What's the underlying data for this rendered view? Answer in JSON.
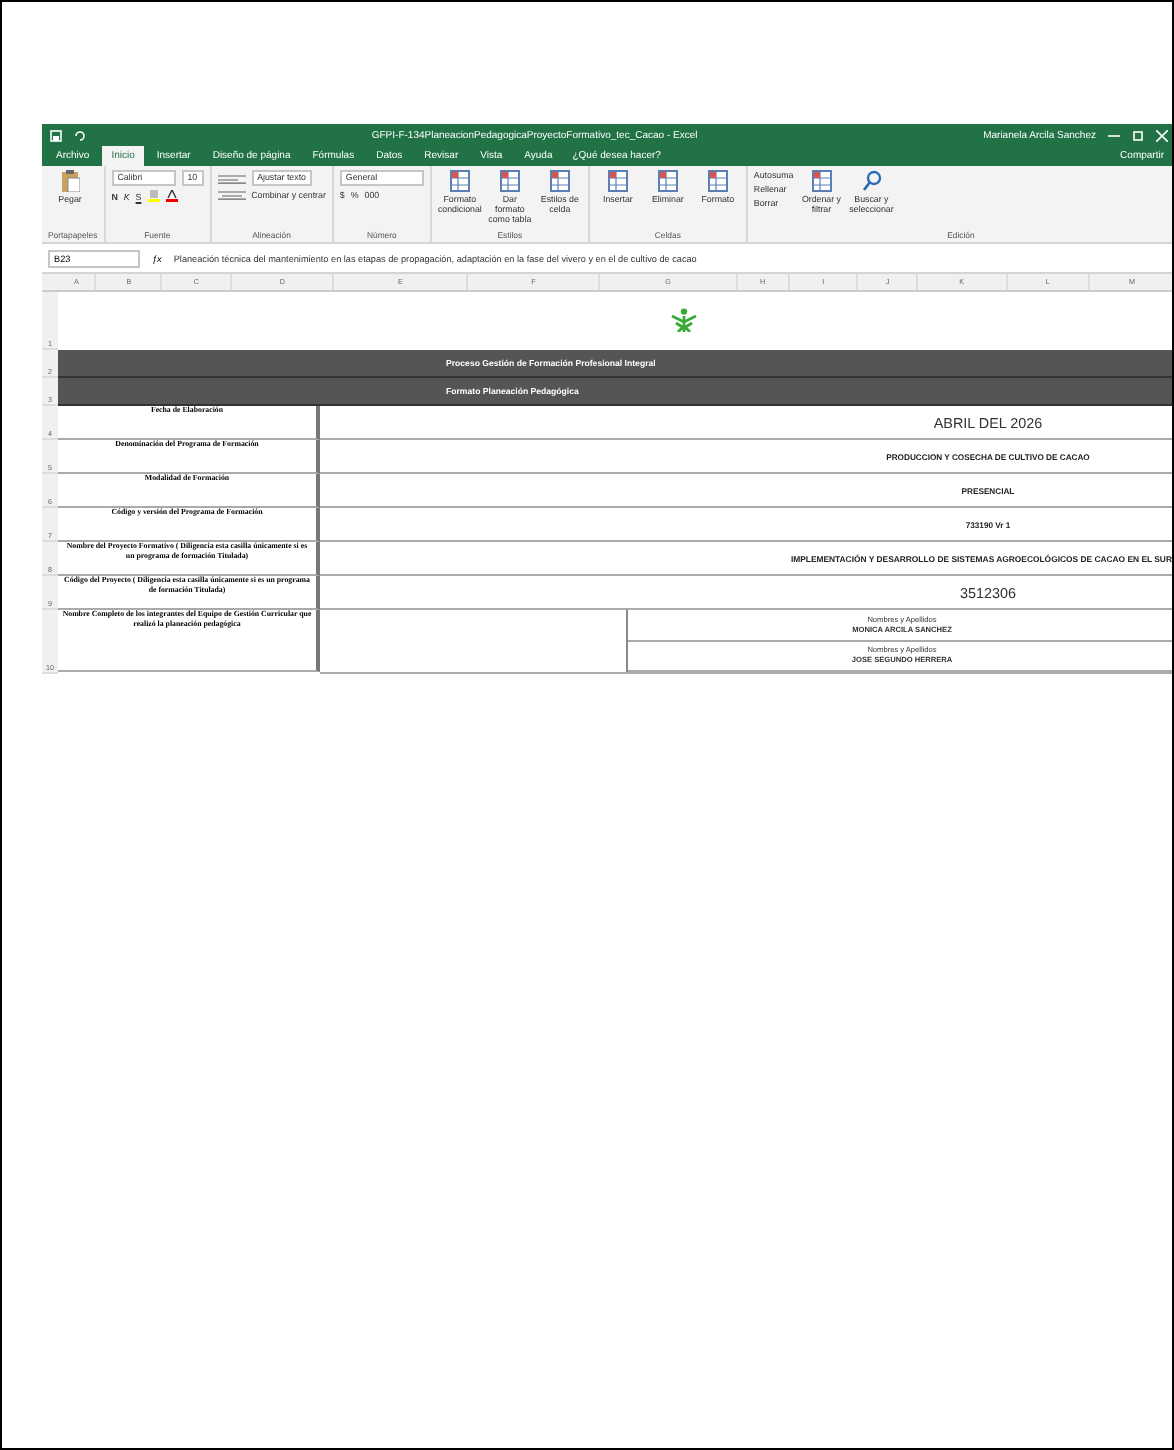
{
  "title_bar": {
    "title": "GFPI-F-134PlaneacionPedagogicaProyectoFormativo_tec_Cacao  -  Excel",
    "user": "Marianela Arcila Sanchez"
  },
  "ribbon_tabs": [
    {
      "label": "Archivo",
      "selected": false
    },
    {
      "label": "Inicio",
      "selected": true
    },
    {
      "label": "Insertar",
      "selected": false
    },
    {
      "label": "Diseño de página",
      "selected": false
    },
    {
      "label": "Fórmulas",
      "selected": false
    },
    {
      "label": "Datos",
      "selected": false
    },
    {
      "label": "Revisar",
      "selected": false
    },
    {
      "label": "Vista",
      "selected": false
    },
    {
      "label": "Ayuda",
      "selected": false
    }
  ],
  "tell_me": "¿Qué desea hacer?",
  "share": "Compartir",
  "font": {
    "name": "Calibri",
    "size": "10",
    "styles": [
      "N",
      "K",
      "S"
    ]
  },
  "number_buttons": [
    "$",
    "%",
    "000"
  ],
  "function_label": "ƒx",
  "row_numbers": [
    "1",
    "2",
    "3",
    "4",
    "5",
    "6",
    "7",
    "8",
    "9",
    "10"
  ],
  "alignment": {
    "wrap": "Ajustar texto",
    "merge": "Combinar y centrar"
  },
  "number_format": "General",
  "ribbon_groups": [
    {
      "name": "Portapapeles",
      "controls": [
        {
          "label": "Pegar",
          "kind": "paste"
        }
      ]
    },
    {
      "name": "Fuente"
    },
    {
      "name": "Alineación"
    },
    {
      "name": "Número"
    },
    {
      "name": "Estilos",
      "controls": [
        {
          "label": "Formato condicional",
          "kind": "large"
        },
        {
          "label": "Dar formato como tabla",
          "kind": "large"
        },
        {
          "label": "Estilos de celda",
          "kind": "large"
        }
      ]
    },
    {
      "name": "Celdas",
      "controls": [
        {
          "label": "Insertar",
          "kind": "large"
        },
        {
          "label": "Eliminar",
          "kind": "large"
        },
        {
          "label": "Formato",
          "kind": "large"
        }
      ]
    },
    {
      "name": "Edición",
      "controls": [
        {
          "label": "Autosuma",
          "kind": "list"
        },
        {
          "label": "Rellenar",
          "kind": "list"
        },
        {
          "label": "Borrar",
          "kind": "list"
        },
        {
          "label": "Ordenar y filtrar",
          "kind": "large"
        },
        {
          "label": "Buscar y seleccionar",
          "kind": "search"
        }
      ]
    }
  ],
  "formula_bar": {
    "cell": "B23",
    "formula": "Planeación técnica del mantenimiento en las etapas de propagación, adaptación en la fase del vivero y en el de cultivo de cacao"
  },
  "columns": [
    "A",
    "B",
    "C",
    "D",
    "E",
    "F",
    "G",
    "H",
    "I",
    "J",
    "K",
    "L",
    "M"
  ],
  "banners": [
    "Proceso Gestión de Formación Profesional Integral",
    "Formato Planeación Pedagógica"
  ],
  "rows": [
    {
      "label": "Fecha de Elaboración",
      "value": "ABRIL DEL 2026",
      "kind": "large"
    },
    {
      "label": "Denominación del Programa de Formación",
      "value": "PRODUCCION Y COSECHA DE CULTIVO DE CACAO",
      "kind": "small"
    },
    {
      "label": "Modalidad de Formación",
      "value": "PRESENCIAL",
      "kind": "small"
    },
    {
      "label": "Código y versión del Programa de Formación",
      "value": "733190 Vr 1",
      "kind": "small"
    },
    {
      "label": "Nombre del Proyecto Formativo  ( Diligencia esta casilla únicamente si es un programa de formación  Titulada)",
      "value": "IMPLEMENTACIÓN Y DESARROLLO DE SISTEMAS AGROECOLÓGICOS DE CACAO EN EL SUR",
      "kind": "cut"
    },
    {
      "label": "Código del Proyecto ( Diligencia esta casilla únicamente si es un programa de formación  Titulada)",
      "value": "3512306",
      "kind": "large"
    }
  ],
  "team": {
    "label": "Nombre Completo de los integrantes del  Equipo de Gestión Curricular  que realizó la planeación pedagógica",
    "members": [
      {
        "caption": "Nombres y Apellidos",
        "name": "MONICA ARCILA SANCHEZ"
      },
      {
        "caption": "Nombres y Apellidos",
        "name": "JOSE SEGUNDO HERRERA"
      }
    ]
  }
}
